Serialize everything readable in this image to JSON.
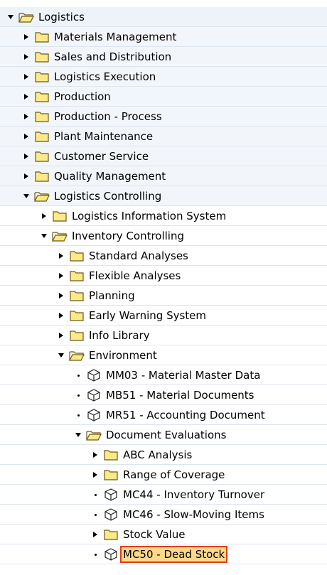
{
  "tree": {
    "nodes": [
      {
        "label": "Logistics",
        "level": 0,
        "state": "open",
        "icon": "folder-open-icon"
      },
      {
        "label": "Materials Management",
        "level": 1,
        "state": "closed",
        "icon": "folder-icon"
      },
      {
        "label": "Sales and Distribution",
        "level": 1,
        "state": "closed",
        "icon": "folder-icon"
      },
      {
        "label": "Logistics Execution",
        "level": 1,
        "state": "closed",
        "icon": "folder-icon"
      },
      {
        "label": "Production",
        "level": 1,
        "state": "closed",
        "icon": "folder-icon"
      },
      {
        "label": "Production - Process",
        "level": 1,
        "state": "closed",
        "icon": "folder-icon"
      },
      {
        "label": "Plant Maintenance",
        "level": 1,
        "state": "closed",
        "icon": "folder-icon"
      },
      {
        "label": "Customer Service",
        "level": 1,
        "state": "closed",
        "icon": "folder-icon"
      },
      {
        "label": "Quality Management",
        "level": 1,
        "state": "closed",
        "icon": "folder-icon"
      },
      {
        "label": "Logistics Controlling",
        "level": 1,
        "state": "open",
        "icon": "folder-open-icon"
      },
      {
        "label": "Logistics Information System",
        "level": 2,
        "state": "closed",
        "icon": "folder-icon"
      },
      {
        "label": "Inventory Controlling",
        "level": 2,
        "state": "open",
        "icon": "folder-open-icon"
      },
      {
        "label": "Standard Analyses",
        "level": 3,
        "state": "closed",
        "icon": "folder-icon"
      },
      {
        "label": "Flexible Analyses",
        "level": 3,
        "state": "closed",
        "icon": "folder-icon"
      },
      {
        "label": "Planning",
        "level": 3,
        "state": "closed",
        "icon": "folder-icon"
      },
      {
        "label": "Early Warning System",
        "level": 3,
        "state": "closed",
        "icon": "folder-icon"
      },
      {
        "label": "Info Library",
        "level": 3,
        "state": "closed",
        "icon": "folder-icon"
      },
      {
        "label": "Environment",
        "level": 3,
        "state": "open",
        "icon": "folder-open-icon"
      },
      {
        "label": "MM03 - Material Master Data",
        "level": 4,
        "state": "leaf",
        "icon": "transaction-cube-icon"
      },
      {
        "label": "MB51 - Material Documents",
        "level": 4,
        "state": "leaf",
        "icon": "transaction-cube-icon"
      },
      {
        "label": "MR51 - Accounting Document",
        "level": 4,
        "state": "leaf",
        "icon": "transaction-cube-icon"
      },
      {
        "label": "Document Evaluations",
        "level": 4,
        "state": "open",
        "icon": "folder-open-icon"
      },
      {
        "label": "ABC Analysis",
        "level": 5,
        "state": "closed",
        "icon": "folder-icon"
      },
      {
        "label": "Range of Coverage",
        "level": 5,
        "state": "closed",
        "icon": "folder-icon"
      },
      {
        "label": "MC44 - Inventory Turnover",
        "level": 5,
        "state": "leaf",
        "icon": "transaction-cube-icon"
      },
      {
        "label": "MC46 - Slow-Moving Items",
        "level": 5,
        "state": "leaf",
        "icon": "transaction-cube-icon"
      },
      {
        "label": "Stock Value",
        "level": 5,
        "state": "closed",
        "icon": "folder-icon"
      },
      {
        "label": "MC50 - Dead Stock",
        "level": 5,
        "state": "leaf",
        "icon": "transaction-cube-icon",
        "selected": true
      }
    ]
  },
  "colors": {
    "folder_fill": "#fbe98a",
    "folder_stroke": "#6a5a1a",
    "selection_bg": "#ffd98a",
    "selection_border": "#e03c1a"
  }
}
